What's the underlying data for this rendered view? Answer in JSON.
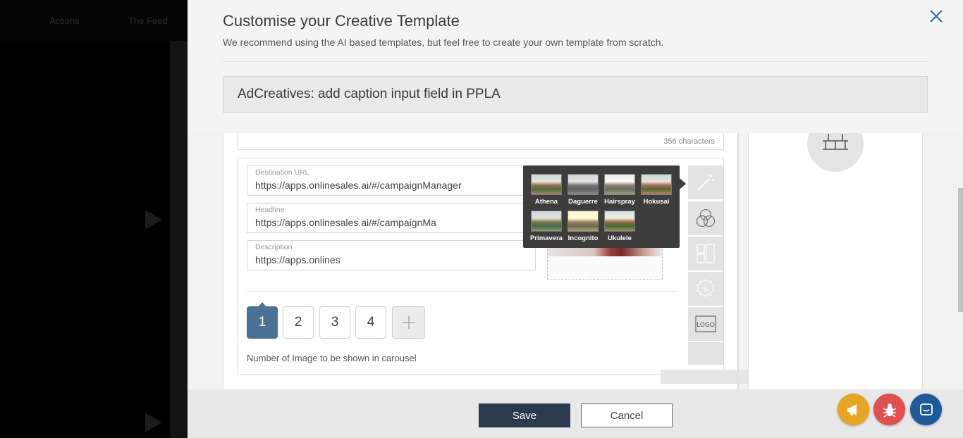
{
  "background_app": {
    "nav_items": [
      "Actions",
      "The Feed"
    ]
  },
  "modal": {
    "title": "Customise your Creative Template",
    "subtitle": "We recommend using the AI based templates, but feel free to create your own template from scratch.",
    "template_name": "AdCreatives: add caption input field in PPLA",
    "close_icon": "close-icon"
  },
  "card": {
    "char_count": "356 characters",
    "fields": [
      {
        "label": "Destination URL",
        "value": "https://apps.onlinesales.ai/#/campaignManager"
      },
      {
        "label": "Headline",
        "value": "https://apps.onlinesales.ai/#/campaignMa"
      },
      {
        "label": "Description",
        "value": "https://apps.onlines"
      }
    ],
    "carousel_numbers": [
      "1",
      "2",
      "3",
      "4"
    ],
    "active_number": "1",
    "carousel_caption": "Number of Image to be shown in carousel"
  },
  "filters": [
    "Athena",
    "Daguerre",
    "Hairspray",
    "Hokusai",
    "Primavera",
    "Incognito",
    "Ukulele"
  ],
  "toolbar_icons": [
    "magic-wand-icon",
    "color-circles-icon",
    "layout-icon",
    "discount-icon",
    "logo-icon"
  ],
  "footer": {
    "save_label": "Save",
    "cancel_label": "Cancel"
  },
  "fabs": [
    {
      "icon": "megaphone-icon",
      "color": "#e8a524"
    },
    {
      "icon": "bug-icon",
      "color": "#e0504f"
    },
    {
      "icon": "chat-icon",
      "color": "#1e5a9a"
    }
  ],
  "colors": {
    "primary": "#2b3a4e",
    "active": "#4a7196"
  }
}
